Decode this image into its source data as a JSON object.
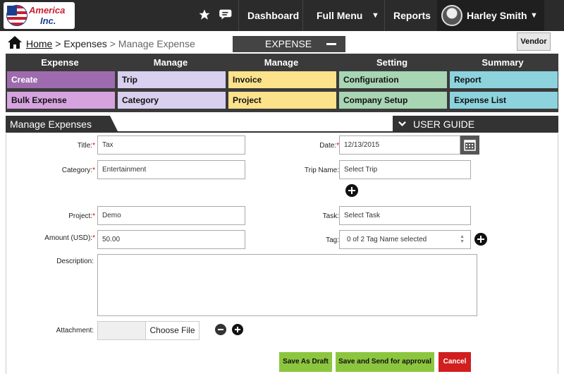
{
  "brand": {
    "line1": "America",
    "line2": "Inc."
  },
  "topnav": {
    "dashboard": "Dashboard",
    "full_menu": "Full Menu",
    "reports": "Reports",
    "user_name": "Harley Smith",
    "caret": "▼"
  },
  "breadcrumb": {
    "home": "Home",
    "sep1": " > ",
    "expenses": "Expenses",
    "sep2": " > ",
    "current": "Manage Expense"
  },
  "module_tab": "EXPENSE",
  "vendor_button": "Vendor",
  "menu": {
    "headers": [
      "Expense",
      "Manage",
      "Manage",
      "Setting",
      "Summary"
    ],
    "row1": [
      "Create",
      "Trip",
      "Invoice",
      "Configuration",
      "Report"
    ],
    "row2": [
      "Bulk Expense",
      "Category",
      "Project",
      "Company Setup",
      "Expense List"
    ],
    "colors_row1": [
      "#9e6bae",
      "#d8d0ee",
      "#fde28c",
      "#a8d5b4",
      "#8dd3dd"
    ],
    "colors_row2": [
      "#d6a3df",
      "#d8d0ee",
      "#fde28c",
      "#a8d5b4",
      "#8dd3dd"
    ],
    "text_colors_row1": [
      "#ffffff",
      "#111111",
      "#111111",
      "#111111",
      "#111111"
    ]
  },
  "section": {
    "title": "Manage Expenses",
    "guide": "USER GUIDE"
  },
  "form": {
    "required_mark": "*",
    "title_label": "Title:",
    "title_value": "Tax",
    "date_label": "Date:",
    "date_value": "12/13/2015",
    "category_label": "Category:",
    "category_value": "Entertainment",
    "trip_label": "Trip Name:",
    "trip_value": "Select Trip",
    "project_label": "Project:",
    "project_value": "Demo",
    "task_label": "Task:",
    "task_value": "Select Task",
    "amount_label": "Amount (USD):",
    "amount_value": "50.00",
    "tag_label": "Tag:",
    "tag_value": "0 of 2 Tag Name selected",
    "description_label": "Description:",
    "attachment_label": "Attachment:",
    "choose_file": "Choose File"
  },
  "actions": {
    "draft": "Save As Draft",
    "send": "Save and Send for approval",
    "cancel": "Cancel"
  },
  "colors": {
    "draft": "#8cc63f",
    "send": "#8cc63f",
    "cancel": "#d11f1f"
  }
}
